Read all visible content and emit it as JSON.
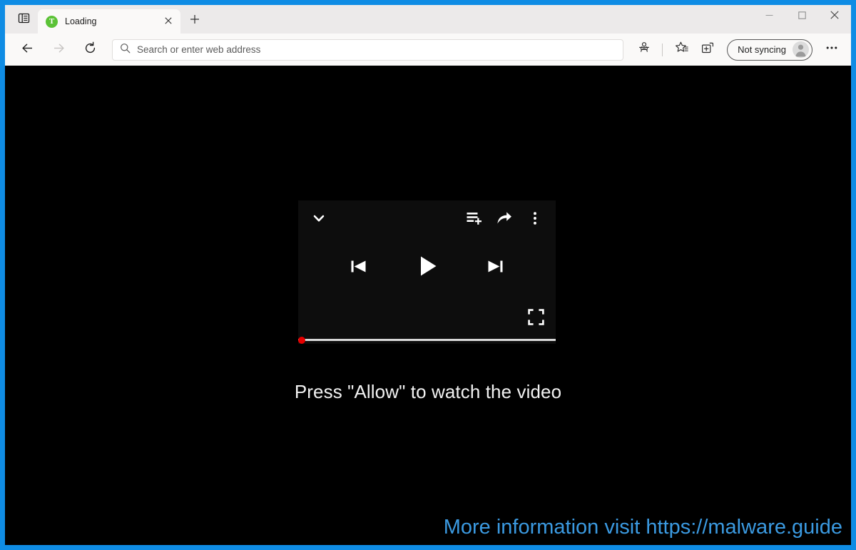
{
  "window": {
    "border_color": "#0f8ce4",
    "controls": {
      "minimize_label": "Minimize",
      "maximize_label": "Maximize",
      "close_label": "Close"
    }
  },
  "tab_strip": {
    "tab_actions_label": "Tab actions menu",
    "new_tab_label": "New tab",
    "tabs": [
      {
        "title": "Loading",
        "favicon_letter": "T",
        "favicon_color": "#5bc236",
        "close_label": "Close tab",
        "active": true
      }
    ]
  },
  "toolbar": {
    "back_label": "Back",
    "forward_label": "Forward",
    "refresh_label": "Refresh",
    "address_placeholder": "Search or enter web address",
    "address_value": "",
    "tracking_prevention_label": "Tracking prevention",
    "favorites_label": "Favorites",
    "collections_label": "Collections",
    "profile_label": "Not syncing",
    "settings_label": "Settings and more"
  },
  "page": {
    "background_color": "#000000",
    "player": {
      "collapse_label": "Collapse player",
      "add_to_queue_label": "Add to queue",
      "share_label": "Share",
      "more_options_label": "More options",
      "previous_label": "Previous track",
      "play_label": "Play",
      "next_label": "Next track",
      "fullscreen_label": "Full screen",
      "progress_percent": 0,
      "progress_handle_color": "#e60000",
      "progress_track_color": "#d8d8d8",
      "background_color": "#0d0d0d"
    },
    "allow_message": "Press \"Allow\" to watch the video",
    "watermark": {
      "text": "More information visit https://malware.guide",
      "color": "#3b9ae1"
    }
  }
}
